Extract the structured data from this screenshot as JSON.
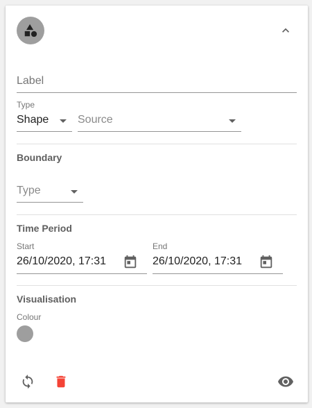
{
  "header": {
    "avatar_icon": "shapes-icon",
    "collapse_icon": "chevron-up-icon"
  },
  "label_field": {
    "placeholder": "Label",
    "value": ""
  },
  "type_field": {
    "label": "Type",
    "value": "Shape"
  },
  "source_field": {
    "placeholder": "Source"
  },
  "boundary": {
    "title": "Boundary",
    "type_placeholder": "Type"
  },
  "time_period": {
    "title": "Time Period",
    "start_label": "Start",
    "start_value": "26/10/2020, 17:31",
    "end_label": "End",
    "end_value": "26/10/2020, 17:31"
  },
  "visualisation": {
    "title": "Visualisation",
    "colour_label": "Colour",
    "colour_value": "#9e9e9e"
  },
  "footer": {
    "refresh_icon": "refresh-icon",
    "delete_icon": "delete-icon",
    "delete_color": "#f44336",
    "visibility_icon": "eye-icon"
  }
}
